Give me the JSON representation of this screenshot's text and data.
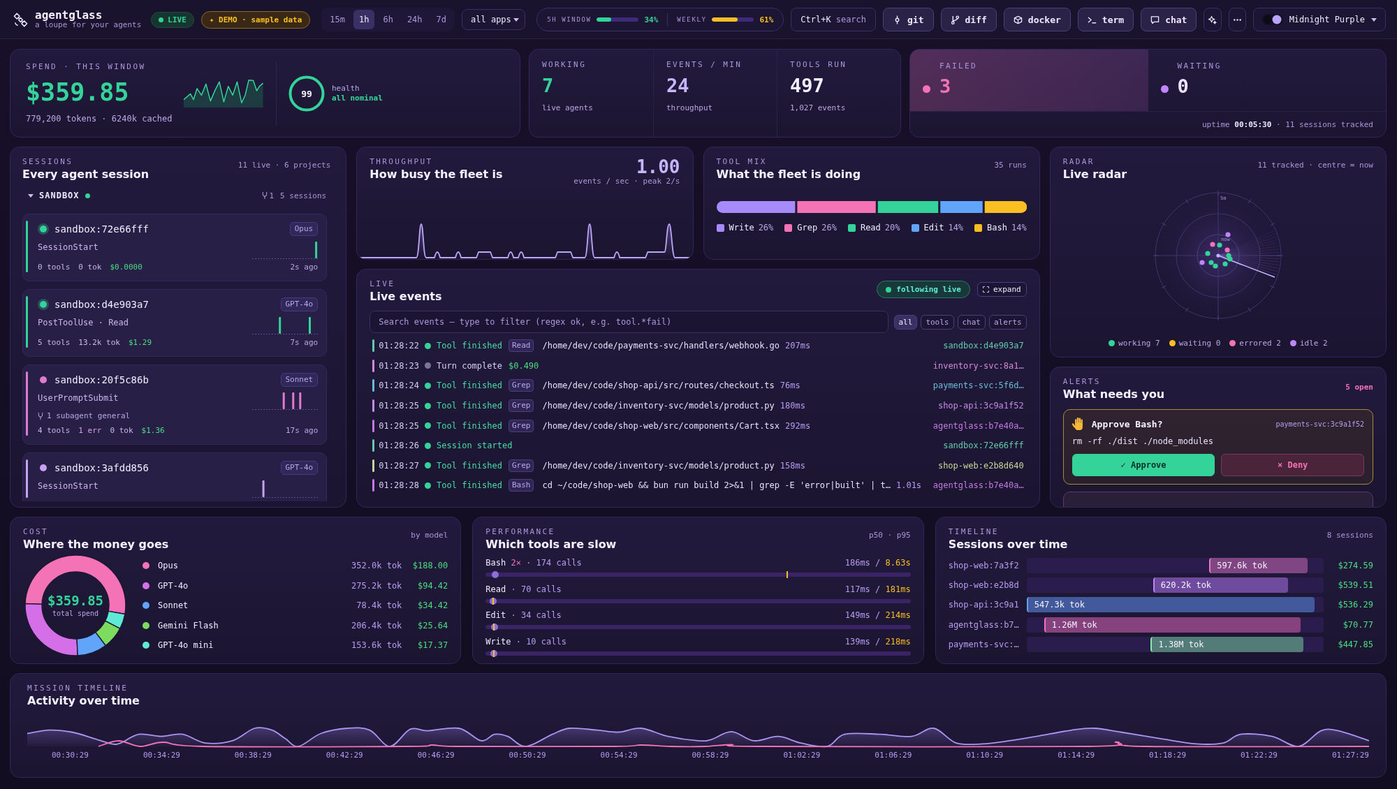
{
  "topbar": {
    "app_name": "agentglass",
    "tagline": "a loupe for your agents",
    "live_badge": "LIVE",
    "demo_badge": "✦ DEMO · sample data",
    "ranges": [
      {
        "label": "15m",
        "selected": false
      },
      {
        "label": "1h",
        "selected": true
      },
      {
        "label": "6h",
        "selected": false
      },
      {
        "label": "24h",
        "selected": false
      },
      {
        "label": "7d",
        "selected": false
      }
    ],
    "app_filter": "all apps",
    "meters": [
      {
        "label": "5H WINDOW",
        "level": 0.34,
        "reading": "34%",
        "color": "#34d399"
      },
      {
        "label": "WEEKLY",
        "level": 0.61,
        "reading": "61%",
        "color": "#fbbf24"
      }
    ],
    "search": {
      "shortcut": "Ctrl+K",
      "label": "search"
    },
    "tools": [
      {
        "kind": "git",
        "label": "git"
      },
      {
        "kind": "diff",
        "label": "diff"
      },
      {
        "kind": "docker",
        "label": "docker"
      },
      {
        "kind": "term",
        "label": "term"
      },
      {
        "kind": "chat",
        "label": "chat"
      }
    ],
    "theme": "Midnight Purple"
  },
  "spend": {
    "label": "SPEND · THIS WINDOW",
    "amount": "$359.85",
    "detail": "779,200 tokens · 6240k cached",
    "health": {
      "score": "99",
      "label": "health",
      "status": "all nominal"
    }
  },
  "counters": [
    {
      "label": "WORKING",
      "value": "7",
      "caption": "live agents",
      "color": "#34d399"
    },
    {
      "label": "EVENTS / MIN",
      "value": "24",
      "caption": "throughput",
      "color": "#c4b5fd"
    },
    {
      "label": "TOOLS RUN",
      "value": "497",
      "caption": "1,027 events",
      "color": "#f5f1ff"
    }
  ],
  "alarms": {
    "items": [
      {
        "label": "FAILED",
        "value": "3",
        "color": "#f472b6",
        "highlighted": true
      },
      {
        "label": "WAITING",
        "value": "0",
        "color": "#c084fc",
        "highlighted": false
      }
    ],
    "footer": "uptime **00:05:30** · 11 sessions tracked"
  },
  "sessions": {
    "label": "SESSIONS",
    "title": "Every agent session",
    "meta": "11 live · 6 projects",
    "groups": [
      {
        "name": "SANDBOX",
        "expanded": true,
        "color": "#34d399",
        "subagents": "1",
        "count": "5 sessions",
        "items": [
          {
            "id": "sandbox:72e66fff",
            "color": "#34d399",
            "active": true,
            "model": "Opus",
            "event": "SessionStart",
            "stats": [
              {
                "kind": "count",
                "text": "0 tools"
              },
              {
                "kind": "count",
                "text": "0 tok"
              },
              {
                "kind": "cost",
                "text": "$0.0000"
              }
            ],
            "age": "2s ago"
          },
          {
            "id": "sandbox:d4e903a7",
            "color": "#34d399",
            "active": true,
            "model": "GPT-4o",
            "event": "PostToolUse · Read",
            "stats": [
              {
                "kind": "count",
                "text": "5 tools"
              },
              {
                "kind": "count",
                "text": "13.2k tok"
              },
              {
                "kind": "cost",
                "text": "$1.29"
              }
            ],
            "age": "7s ago"
          },
          {
            "id": "sandbox:20f5c86b",
            "color": "#e07ad0",
            "active": false,
            "model": "Sonnet",
            "event": "UserPromptSubmit",
            "subagent": "1 subagent general",
            "stats": [
              {
                "kind": "count",
                "text": "4 tools"
              },
              {
                "kind": "error",
                "text": "1 err"
              },
              {
                "kind": "count",
                "text": "0 tok"
              },
              {
                "kind": "cost",
                "text": "$1.36"
              }
            ],
            "age": "17s ago"
          },
          {
            "id": "sandbox:3afdd856",
            "color": "#c8a2f0",
            "active": false,
            "model": "GPT-4o",
            "event": "SessionStart"
          }
        ]
      }
    ]
  },
  "throughput": {
    "label": "THROUGHPUT",
    "title": "How busy the fleet is",
    "rate": "1.00",
    "caption": "events / sec · peak 2/s"
  },
  "tool_mix": {
    "label": "TOOL MIX",
    "title": "What the fleet is doing",
    "meta": "35 runs",
    "legend": [
      {
        "name": "Write",
        "share": "26%",
        "color": "#a78bfa"
      },
      {
        "name": "Grep",
        "share": "26%",
        "color": "#f472b6"
      },
      {
        "name": "Read",
        "share": "20%",
        "color": "#34d399"
      },
      {
        "name": "Edit",
        "share": "14%",
        "color": "#60a5fa"
      },
      {
        "name": "Bash",
        "share": "14%",
        "color": "#fbbf24"
      }
    ]
  },
  "radar": {
    "label": "RADAR",
    "title": "Live radar",
    "meta": "11 tracked · centre = now",
    "ring_labels": [
      "5m",
      "now"
    ],
    "legend": [
      {
        "label": "working 7",
        "color": "#34d399"
      },
      {
        "label": "waiting 0",
        "color": "#fbbf24"
      },
      {
        "label": "errored 2",
        "color": "#f472b6"
      },
      {
        "label": "idle 2",
        "color": "#c084fc"
      }
    ]
  },
  "live": {
    "label": "LIVE",
    "title": "Live events",
    "follow": {
      "label": "following live",
      "on": true
    },
    "expand": "expand",
    "search_placeholder": "Search events — type to filter (regex ok, e.g. tool.*fail)",
    "filters": [
      {
        "label": "all",
        "selected": true
      },
      {
        "label": "tools",
        "selected": false
      },
      {
        "label": "chat",
        "selected": false
      },
      {
        "label": "alerts",
        "selected": false
      }
    ],
    "events": [
      {
        "kind": "tool",
        "time": "01:28:22",
        "message": "Tool finished",
        "tool": "Read",
        "detail": "/home/dev/code/payments-svc/handlers/webhook.go",
        "duration": "207ms",
        "session": "sandbox:d4e903a7",
        "color": "#62c9ab"
      },
      {
        "kind": "turn",
        "time": "01:28:23",
        "message": "Turn complete",
        "cost": "$0.490",
        "session": "inventory-svc:8a1…",
        "color": "#d48ad8"
      },
      {
        "kind": "tool",
        "time": "01:28:24",
        "message": "Tool finished",
        "tool": "Grep",
        "detail": "/home/dev/code/shop-api/src/routes/checkout.ts",
        "duration": "76ms",
        "session": "payments-svc:5f6d…",
        "color": "#6cb9d6"
      },
      {
        "kind": "tool",
        "time": "01:28:25",
        "message": "Tool finished",
        "tool": "Grep",
        "detail": "/home/dev/code/inventory-svc/models/product.py",
        "duration": "180ms",
        "session": "shop-api:3c9a1f52",
        "color": "#c48ae8"
      },
      {
        "kind": "tool",
        "time": "01:28:25",
        "message": "Tool finished",
        "tool": "Grep",
        "detail": "/home/dev/code/shop-web/src/components/Cart.tsx",
        "duration": "292ms",
        "session": "agentglass:b7e40a…",
        "color": "#c27ae0"
      },
      {
        "kind": "session",
        "time": "01:28:26",
        "message": "Session started",
        "session": "sandbox:72e66fff",
        "color": "#62c9ab"
      },
      {
        "kind": "tool",
        "time": "01:28:27",
        "message": "Tool finished",
        "tool": "Grep",
        "detail": "/home/dev/code/inventory-svc/models/product.py",
        "duration": "158ms",
        "session": "shop-web:e2b8d640",
        "color": "#c4d69a"
      },
      {
        "kind": "tool",
        "time": "01:28:28",
        "message": "Tool finished",
        "tool": "Bash",
        "detail": "cd ~/code/shop-web && bun run build 2>&1 | grep -E 'error|built' | t…",
        "duration": "1.01s",
        "session": "agentglass:b7e40a…",
        "color": "#c27ae0"
      }
    ]
  },
  "alerts": {
    "label": "ALERTS",
    "title": "What needs you",
    "meta": "5 open",
    "items": [
      {
        "title": "Approve Bash?",
        "session": "payments-svc:3c9a1f52",
        "command": "rm -rf ./dist ./node_modules",
        "actions": [
          {
            "kind": "approve",
            "label": "✓ Approve"
          },
          {
            "kind": "deny",
            "label": "× Deny"
          }
        ]
      }
    ]
  },
  "cost": {
    "label": "COST",
    "title": "Where the money goes",
    "meta": "by model",
    "total": "$359.85",
    "total_label": "total spend",
    "chart_data": {
      "type": "donut",
      "categories": [
        "Opus",
        "GPT-4o",
        "Sonnet",
        "Gemini Flash",
        "GPT-4o mini"
      ],
      "values": [
        52.24,
        26.24,
        9.56,
        7.13,
        4.83
      ]
    },
    "legend": [
      {
        "color": "#f472b6",
        "tokens": "352.0k tok",
        "cost": "$188.00"
      },
      {
        "color": "#d46fe8",
        "tokens": "275.2k tok",
        "cost": "$94.42"
      },
      {
        "color": "#60a5fa",
        "tokens": "78.4k tok",
        "cost": "$34.42"
      },
      {
        "color": "#7ddc5e",
        "tokens": "206.4k tok",
        "cost": "$25.64"
      },
      {
        "color": "#5eead4",
        "tokens": "153.6k tok",
        "cost": "$17.37"
      }
    ]
  },
  "performance": {
    "label": "PERFORMANCE",
    "title": "Which tools are slow",
    "meta": "p50 · p95",
    "tools": [
      {
        "name": "Bash",
        "flag": "2×",
        "calls": "· 174 calls",
        "p50": {
          "text": "186ms /",
          "level": 0.015
        },
        "p95": {
          "text": "8.63s",
          "level": 0.71
        }
      },
      {
        "name": "Read",
        "calls": "· 70 calls",
        "p50": {
          "text": "117ms /",
          "level": 0.01
        },
        "p95": {
          "text": "181ms",
          "level": 0.016
        }
      },
      {
        "name": "Edit",
        "calls": "· 34 calls",
        "p50": {
          "text": "149ms /",
          "level": 0.012
        },
        "p95": {
          "text": "214ms",
          "level": 0.018
        }
      },
      {
        "name": "Write",
        "calls": "· 10 calls",
        "p50": {
          "text": "139ms /",
          "level": 0.011
        },
        "p95": {
          "text": "218ms",
          "level": 0.018
        }
      }
    ]
  },
  "timeline": {
    "label": "TIMELINE",
    "title": "Sessions over time",
    "meta": "8 sessions",
    "rows": [
      {
        "session": "shop-web:7a3f2",
        "tokens": "597.6k tok",
        "cost": "$274.59",
        "color": "#e879c6"
      },
      {
        "session": "shop-web:e2b8d",
        "tokens": "620.2k tok",
        "cost": "$539.51",
        "color": "#c084fc"
      },
      {
        "session": "shop-api:3c9a1",
        "tokens": "547.3k tok",
        "cost": "$536.29",
        "color": "#60a5fa"
      },
      {
        "session": "agentglass:b7…",
        "tokens": "1.26M tok",
        "cost": "$70.77",
        "color": "#f472b6"
      },
      {
        "session": "payments-svc:…",
        "tokens": "1.38M tok",
        "cost": "$447.85",
        "color": "#86efac"
      }
    ]
  },
  "mission": {
    "label": "MISSION TIMELINE",
    "title": "Activity over time",
    "ticks": [
      "00:30:29",
      "00:34:29",
      "00:38:29",
      "00:42:29",
      "00:46:29",
      "00:50:29",
      "00:54:29",
      "00:58:29",
      "01:02:29",
      "01:06:29",
      "01:10:29",
      "01:14:29",
      "01:18:29",
      "01:22:29",
      "01:27:29"
    ]
  }
}
